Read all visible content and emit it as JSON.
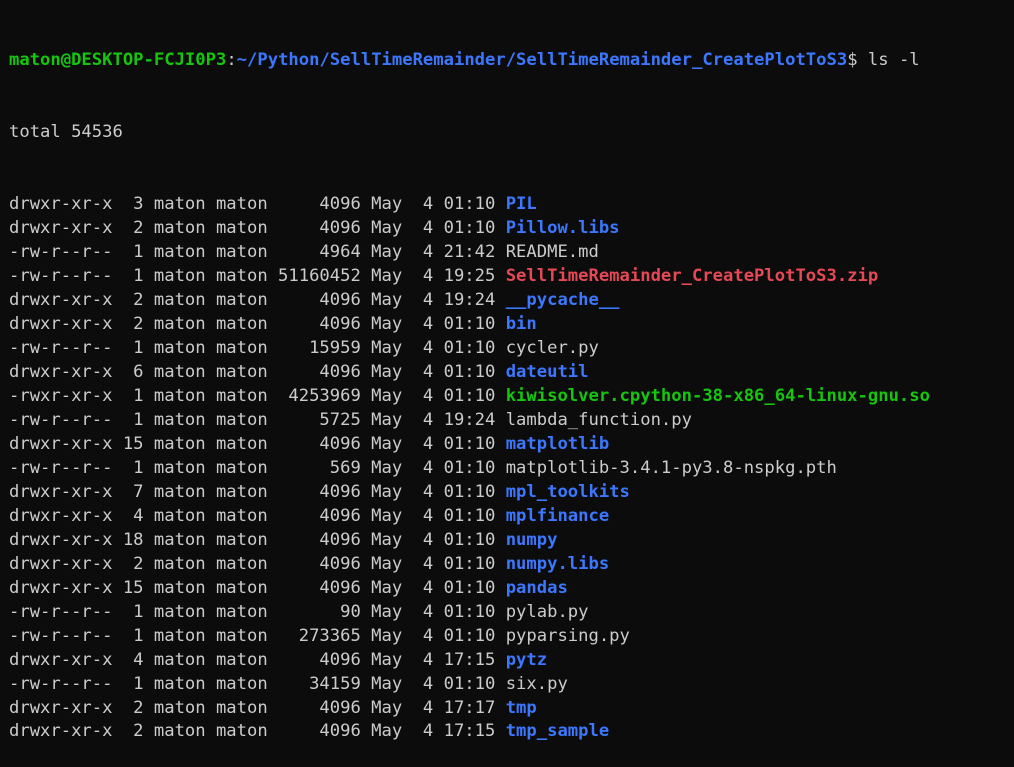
{
  "prompt": {
    "user_host": "maton@DESKTOP-FCJI0P3",
    "separator": ":",
    "path": "~/Python/SellTimeRemainder/SellTimeRemainder_CreatePlotToS3",
    "symbol": "$",
    "command": " ls -l"
  },
  "total": "total 54536",
  "colors": {
    "background": "#0c0c0c",
    "text": "#cccccc",
    "directory": "#3b78ff",
    "archive": "#e74856",
    "executable": "#16c60c"
  },
  "entries": [
    {
      "meta": "drwxr-xr-x  3 maton maton     4096 May  4 01:10 ",
      "name": "PIL",
      "type": "dir"
    },
    {
      "meta": "drwxr-xr-x  2 maton maton     4096 May  4 01:10 ",
      "name": "Pillow.libs",
      "type": "dir"
    },
    {
      "meta": "-rw-r--r--  1 maton maton     4964 May  4 21:42 ",
      "name": "README.md",
      "type": "file"
    },
    {
      "meta": "-rw-r--r--  1 maton maton 51160452 May  4 19:25 ",
      "name": "SellTimeRemainder_CreatePlotToS3.zip",
      "type": "zip"
    },
    {
      "meta": "drwxr-xr-x  2 maton maton     4096 May  4 19:24 ",
      "name": "__pycache__",
      "type": "dir"
    },
    {
      "meta": "drwxr-xr-x  2 maton maton     4096 May  4 01:10 ",
      "name": "bin",
      "type": "dir"
    },
    {
      "meta": "-rw-r--r--  1 maton maton    15959 May  4 01:10 ",
      "name": "cycler.py",
      "type": "file"
    },
    {
      "meta": "drwxr-xr-x  6 maton maton     4096 May  4 01:10 ",
      "name": "dateutil",
      "type": "dir"
    },
    {
      "meta": "-rwxr-xr-x  1 maton maton  4253969 May  4 01:10 ",
      "name": "kiwisolver.cpython-38-x86_64-linux-gnu.so",
      "type": "exec"
    },
    {
      "meta": "-rw-r--r--  1 maton maton     5725 May  4 19:24 ",
      "name": "lambda_function.py",
      "type": "file"
    },
    {
      "meta": "drwxr-xr-x 15 maton maton     4096 May  4 01:10 ",
      "name": "matplotlib",
      "type": "dir"
    },
    {
      "meta": "-rw-r--r--  1 maton maton      569 May  4 01:10 ",
      "name": "matplotlib-3.4.1-py3.8-nspkg.pth",
      "type": "file"
    },
    {
      "meta": "drwxr-xr-x  7 maton maton     4096 May  4 01:10 ",
      "name": "mpl_toolkits",
      "type": "dir"
    },
    {
      "meta": "drwxr-xr-x  4 maton maton     4096 May  4 01:10 ",
      "name": "mplfinance",
      "type": "dir"
    },
    {
      "meta": "drwxr-xr-x 18 maton maton     4096 May  4 01:10 ",
      "name": "numpy",
      "type": "dir"
    },
    {
      "meta": "drwxr-xr-x  2 maton maton     4096 May  4 01:10 ",
      "name": "numpy.libs",
      "type": "dir"
    },
    {
      "meta": "drwxr-xr-x 15 maton maton     4096 May  4 01:10 ",
      "name": "pandas",
      "type": "dir"
    },
    {
      "meta": "-rw-r--r--  1 maton maton       90 May  4 01:10 ",
      "name": "pylab.py",
      "type": "file"
    },
    {
      "meta": "-rw-r--r--  1 maton maton   273365 May  4 01:10 ",
      "name": "pyparsing.py",
      "type": "file"
    },
    {
      "meta": "drwxr-xr-x  4 maton maton     4096 May  4 17:15 ",
      "name": "pytz",
      "type": "dir"
    },
    {
      "meta": "-rw-r--r--  1 maton maton    34159 May  4 01:10 ",
      "name": "six.py",
      "type": "file"
    },
    {
      "meta": "drwxr-xr-x  2 maton maton     4096 May  4 17:17 ",
      "name": "tmp",
      "type": "dir"
    },
    {
      "meta": "drwxr-xr-x  2 maton maton     4096 May  4 17:15 ",
      "name": "tmp_sample",
      "type": "dir"
    }
  ]
}
